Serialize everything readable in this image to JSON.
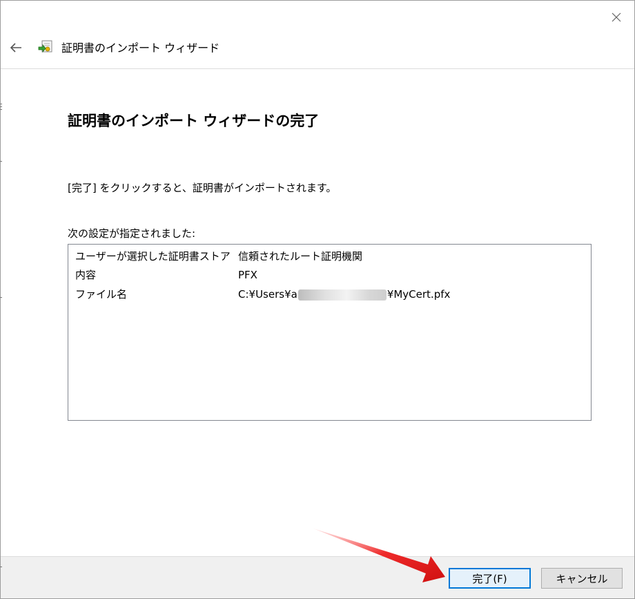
{
  "window": {
    "title": "証明書のインポート ウィザード",
    "close_icon": "close-icon",
    "back_icon": "back-arrow-icon",
    "app_icon": "certificate-import-icon"
  },
  "main": {
    "heading": "証明書のインポート ウィザードの完了",
    "instruction": "[完了] をクリックすると、証明書がインポートされます。",
    "settings_label": "次の設定が指定されました:",
    "settings": [
      {
        "key": "ユーザーが選択した証明書ストア",
        "value": "信頼されたルート証明機関"
      },
      {
        "key": "内容",
        "value": "PFX"
      },
      {
        "key": "ファイル名",
        "value_prefix": "C:¥Users¥a",
        "value_suffix": "¥MyCert.pfx",
        "redacted": true
      }
    ]
  },
  "footer": {
    "finish_label": "完了(F)",
    "cancel_label": "キャンセル"
  },
  "annotation": {
    "arrow_color": "#e81c1c",
    "arrow_icon": "red-arrow-annotation"
  },
  "colors": {
    "focus_border": "#0078d7",
    "footer_bg": "#f0f0f0"
  }
}
